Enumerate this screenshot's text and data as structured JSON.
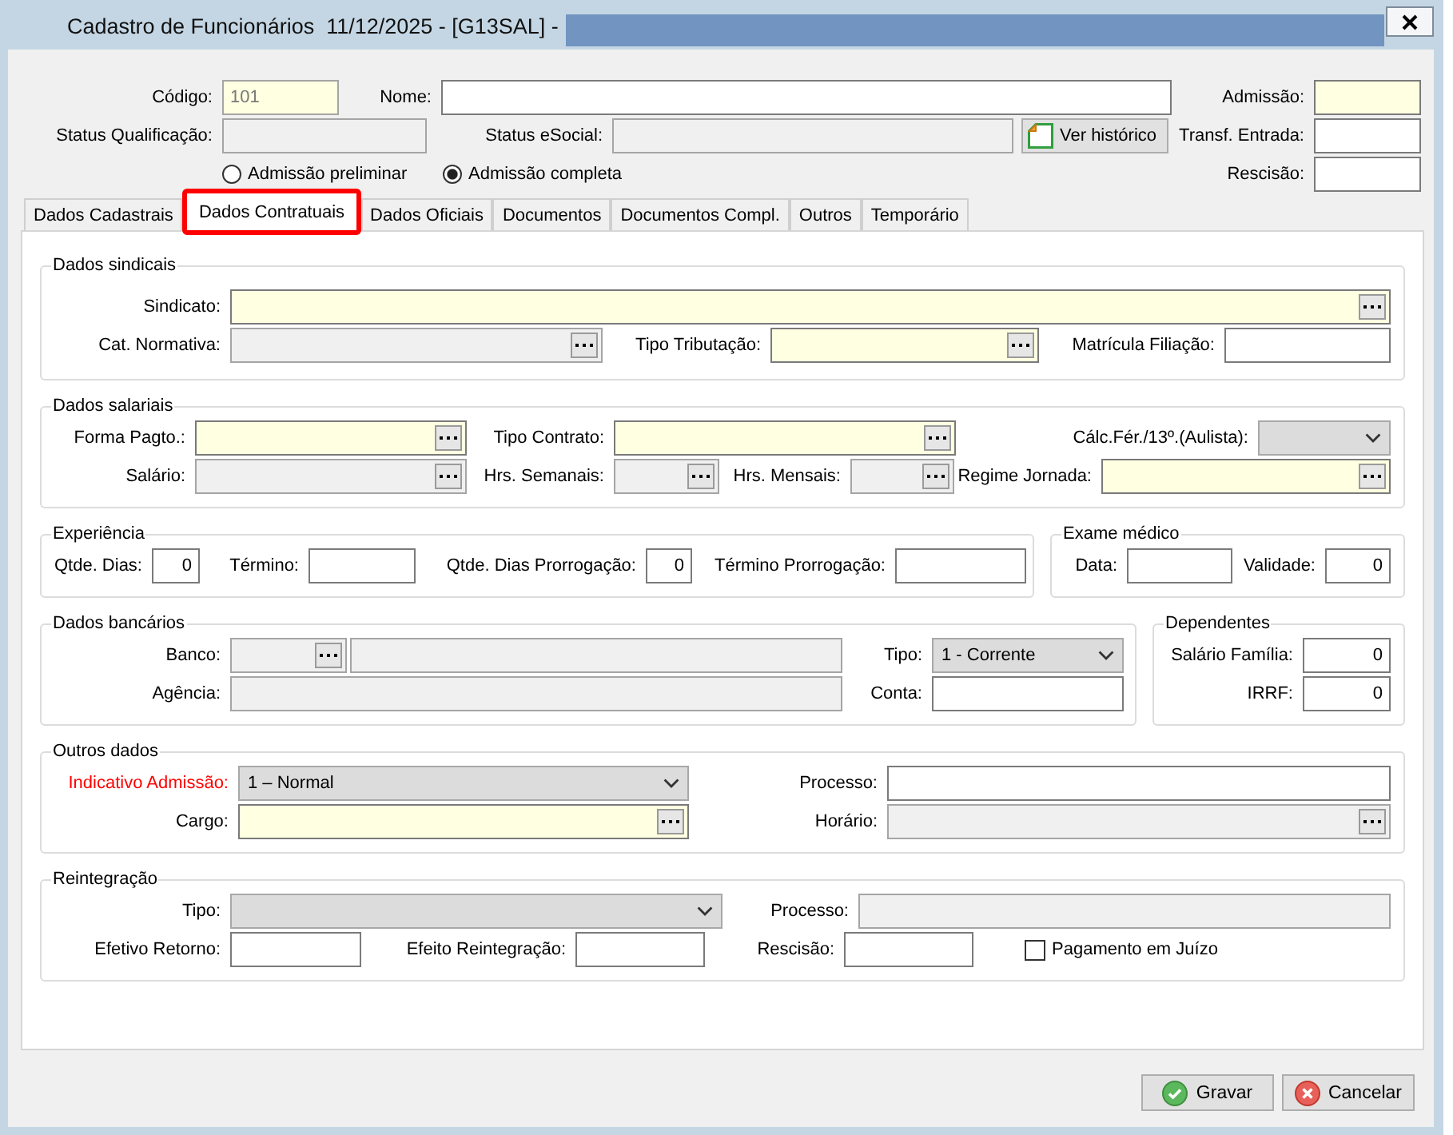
{
  "window": {
    "title": "Cadastro de Funcionários  11/12/2025 - [G13SAL] -"
  },
  "header": {
    "rows": [
      [
        {
          "label": "Código:",
          "kind": "field",
          "value": "101",
          "required": true,
          "disabled": true
        },
        {
          "label": "Nome:",
          "kind": "field",
          "required": false,
          "disabled": false
        },
        {
          "label": "Admissão:",
          "kind": "field",
          "required": true,
          "disabled": false
        }
      ],
      [
        {
          "label": "Status Qualificação:",
          "kind": "field",
          "required": false,
          "disabled": true
        },
        {
          "label": "Status eSocial:",
          "kind": "field",
          "required": false,
          "disabled": true
        },
        {
          "kind": "button",
          "text": "Ver histórico"
        },
        {
          "label": "Transf. Entrada:",
          "kind": "field",
          "required": false,
          "disabled": false
        }
      ],
      [
        {
          "kind": "radio",
          "text": "Admissão preliminar",
          "selected": false
        },
        {
          "kind": "radio",
          "text": "Admissão completa",
          "selected": true
        },
        {
          "label": "Rescisão:",
          "kind": "field",
          "required": false,
          "disabled": false
        }
      ]
    ]
  },
  "tabs": [
    {
      "label": "Dados Cadastrais",
      "selected": false
    },
    {
      "label": "Dados Contratuais",
      "selected": true
    },
    {
      "label": "Dados Oficiais",
      "selected": false
    },
    {
      "label": "Documentos",
      "selected": false
    },
    {
      "label": "Documentos Compl.",
      "selected": false
    },
    {
      "label": "Outros",
      "selected": false
    },
    {
      "label": "Temporário",
      "selected": false
    }
  ],
  "groups": [
    {
      "title": "Dados sindicais",
      "rows": [
        [
          {
            "label": "Sindicato:",
            "kind": "lookup",
            "required": true,
            "disabled": false
          }
        ],
        [
          {
            "label": "Cat. Normativa:",
            "kind": "lookup",
            "required": false,
            "disabled": true
          },
          {
            "label": "Tipo Tributação:",
            "kind": "lookup",
            "required": true,
            "disabled": false
          },
          {
            "label": "Matrícula Filiação:",
            "kind": "field",
            "required": false,
            "disabled": false
          }
        ]
      ]
    },
    {
      "title": "Dados salariais",
      "rows": [
        [
          {
            "label": "Forma Pagto.:",
            "kind": "lookup",
            "required": true,
            "disabled": false
          },
          {
            "label": "Tipo Contrato:",
            "kind": "lookup",
            "required": true,
            "disabled": false
          },
          {
            "label": "Cálc.Fér./13º.(Aulista):",
            "kind": "select"
          }
        ],
        [
          {
            "label": "Salário:",
            "kind": "lookup",
            "required": false,
            "disabled": true
          },
          {
            "label": "Hrs. Semanais:",
            "kind": "lookup",
            "required": false,
            "disabled": true
          },
          {
            "label": "Hrs. Mensais:",
            "kind": "lookup",
            "required": false,
            "disabled": true
          },
          {
            "label": "Regime Jornada:",
            "kind": "lookup",
            "required": true,
            "disabled": false
          }
        ]
      ]
    },
    {
      "title": "Experiência",
      "rows": [
        [
          {
            "label": "Qtde. Dias:",
            "kind": "number",
            "value": "0",
            "required": false,
            "disabled": false
          },
          {
            "label": "Término:",
            "kind": "field",
            "required": false,
            "disabled": false
          },
          {
            "label": "Qtde. Dias Prorrogação:",
            "kind": "number",
            "value": "0",
            "required": false,
            "disabled": false
          },
          {
            "label": "Término Prorrogação:",
            "kind": "field",
            "required": false,
            "disabled": false
          }
        ]
      ]
    },
    {
      "title": "Exame médico",
      "rows": [
        [
          {
            "label": "Data:",
            "kind": "field",
            "required": false,
            "disabled": false
          },
          {
            "label": "Validade:",
            "kind": "number",
            "value": "0",
            "required": false,
            "disabled": false
          }
        ]
      ]
    },
    {
      "title": "Dados bancários",
      "rows": [
        [
          {
            "label": "Banco:",
            "kind": "lookup",
            "required": false,
            "disabled": true
          },
          {
            "kind": "field",
            "required": false,
            "disabled": true
          },
          {
            "label": "Tipo:",
            "kind": "select",
            "value": "1 - Corrente"
          }
        ],
        [
          {
            "label": "Agência:",
            "kind": "field",
            "required": false,
            "disabled": true
          },
          {
            "label": "Conta:",
            "kind": "field",
            "required": false,
            "disabled": false
          }
        ]
      ]
    },
    {
      "title": "Dependentes",
      "rows": [
        [
          {
            "label": "Salário Família:",
            "kind": "number",
            "value": "0",
            "required": false,
            "disabled": false
          }
        ],
        [
          {
            "label": "IRRF:",
            "kind": "number",
            "value": "0",
            "required": false,
            "disabled": false
          }
        ]
      ]
    },
    {
      "title": "Outros dados",
      "rows": [
        [
          {
            "label": "Indicativo Admissão:",
            "emphasized": true,
            "kind": "select",
            "value": "1 – Normal"
          },
          {
            "label": "Processo:",
            "emphasized": false,
            "kind": "field",
            "required": false,
            "disabled": false
          }
        ],
        [
          {
            "label": "Cargo:",
            "emphasized": false,
            "kind": "lookup",
            "required": true,
            "disabled": false
          },
          {
            "label": "Horário:",
            "emphasized": false,
            "kind": "lookup",
            "required": false,
            "disabled": true
          }
        ]
      ]
    },
    {
      "title": "Reintegração",
      "rows": [
        [
          {
            "label": "Tipo:",
            "kind": "select"
          },
          "",
          {
            "label": "Processo:",
            "kind": "field",
            "required": false,
            "disabled": true
          }
        ],
        [
          {
            "label": "Efetivo Retorno:",
            "kind": "field",
            "required": false,
            "disabled": false
          },
          {
            "label": "Efeito Reintegração:",
            "kind": "field",
            "required": false,
            "disabled": false
          },
          {
            "label": "Rescisão:",
            "kind": "field",
            "required": false,
            "disabled": false
          },
          {
            "kind": "checkbox",
            "text": "Pagamento em Juízo",
            "checked": false
          }
        ]
      ]
    }
  ],
  "buttons": [
    {
      "kind": "save",
      "text": "Gravar"
    },
    {
      "kind": "cancel",
      "text": "Cancelar"
    }
  ]
}
